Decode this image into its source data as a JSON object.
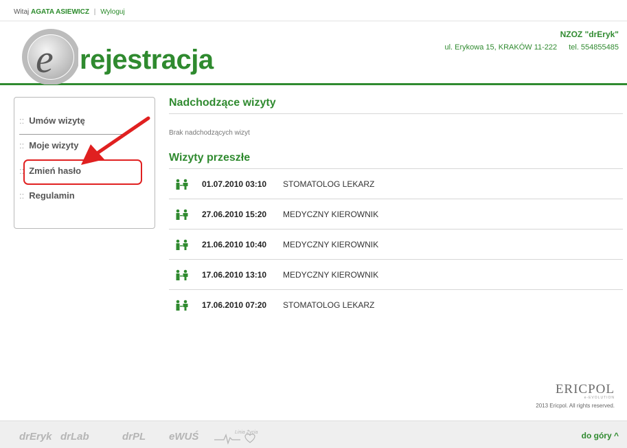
{
  "topbar": {
    "greeting": "Witaj",
    "user_name": "AGATA ASIEWICZ",
    "separator": "|",
    "logout": "Wyloguj"
  },
  "header": {
    "logo_text": "rejestracja",
    "clinic_name": "NZOZ \"drEryk\"",
    "clinic_address": "ul. Erykowa 15, KRAKÓW 11-222",
    "clinic_phone": "tel. 554855485"
  },
  "sidebar": {
    "items": [
      {
        "dots": "::",
        "label": "Umów wizytę"
      },
      {
        "dots": "::",
        "label": "Moje wizyty"
      },
      {
        "dots": "::",
        "label": "Zmień hasło"
      },
      {
        "dots": "::",
        "label": "Regulamin"
      }
    ]
  },
  "main": {
    "upcoming_title": "Nadchodzące wizyty",
    "upcoming_empty": "Brak nadchodzących wizyt",
    "past_title": "Wizyty przeszłe",
    "past_visits": [
      {
        "datetime": "01.07.2010 03:10",
        "doctor": "STOMATOLOG LEKARZ"
      },
      {
        "datetime": "27.06.2010 15:20",
        "doctor": "MEDYCZNY KIEROWNIK"
      },
      {
        "datetime": "21.06.2010 10:40",
        "doctor": "MEDYCZNY KIEROWNIK"
      },
      {
        "datetime": "17.06.2010 13:10",
        "doctor": "MEDYCZNY KIEROWNIK"
      },
      {
        "datetime": "17.06.2010 07:20",
        "doctor": "STOMATOLOG LEKARZ"
      }
    ]
  },
  "footer": {
    "brand": "ERICPOL",
    "brand_sub": "e-EVOLUTION",
    "copyright": "2013 Ericpol. All rights reserved.",
    "bottom_logos": [
      "drEryk",
      "drLab",
      "drPL",
      "eWUŚ",
      "Linia Życia"
    ],
    "to_top": "do góry ^"
  },
  "colors": {
    "brand_green": "#2f8a2f",
    "highlight_red": "#e02020"
  }
}
